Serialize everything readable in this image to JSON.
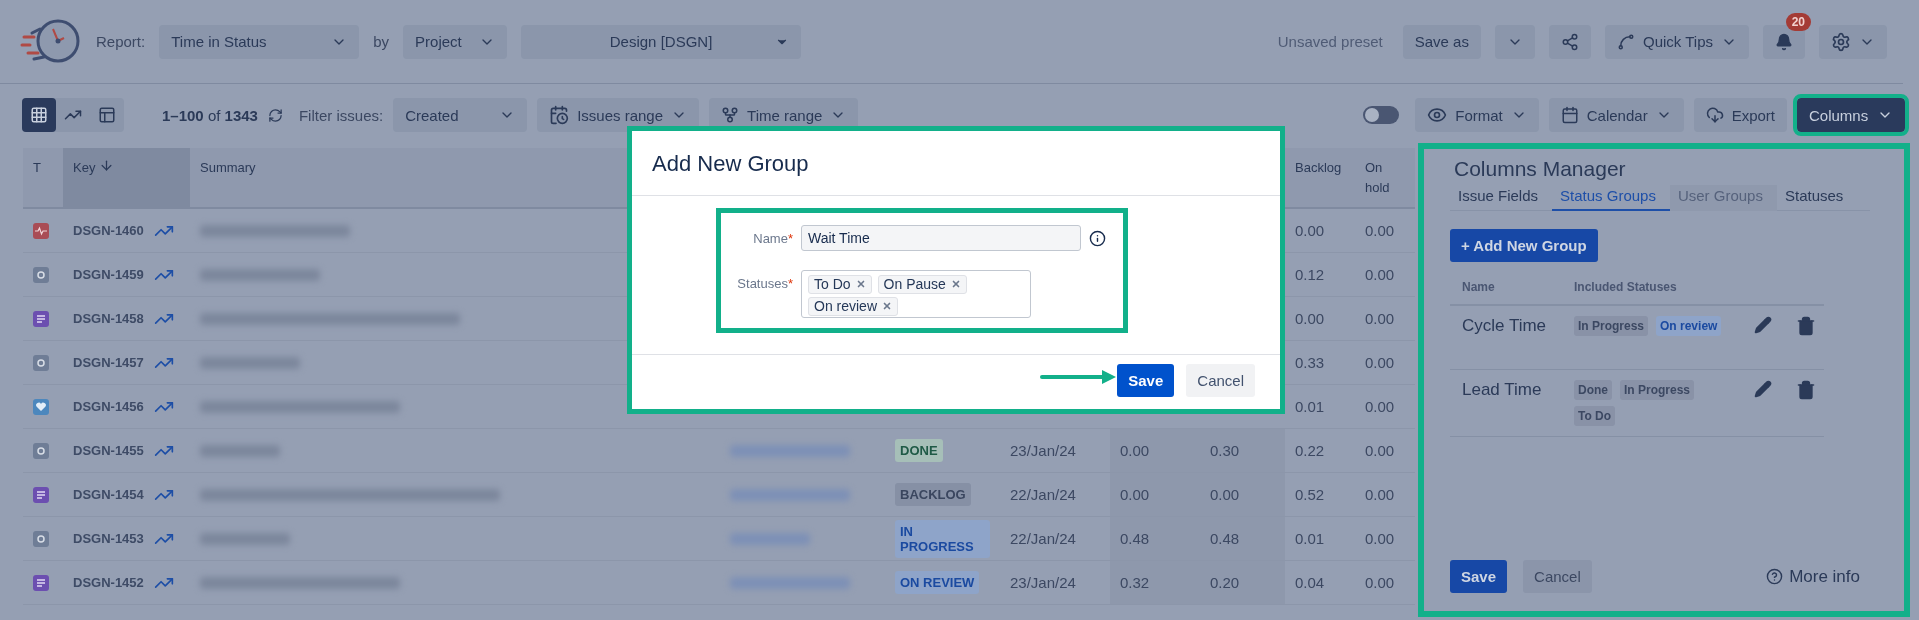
{
  "toolbar": {
    "report_label": "Report:",
    "report": "Time in Status",
    "by_label": "by",
    "group_by": "Project",
    "project": "Design [DSGN]",
    "preset": "Unsaved preset",
    "save_as": "Save as",
    "quick_tips": "Quick Tips",
    "notifications": "20"
  },
  "filters": {
    "views": [
      {
        "kind": "grid",
        "selected": true
      },
      {
        "kind": "chart",
        "selected": false
      },
      {
        "kind": "panel",
        "selected": false
      }
    ],
    "range": "**1–100** of **1343**",
    "filter_label": "Filter issues:",
    "filter": "Created",
    "issues_range": "Issues range",
    "time_range": "Time range",
    "toggle_on": false,
    "format": "Format",
    "calendar": "Calendar",
    "export": "Export",
    "columns": "Columns",
    "columns_open": true
  },
  "table": {
    "columns": [
      {
        "kind": "t",
        "label": "T",
        "sorted": false
      },
      {
        "kind": "key",
        "label": "Key",
        "sorted": true
      },
      {
        "kind": "summary",
        "label": "Summary",
        "sorted": false
      },
      {
        "kind": "backlog",
        "label": "Backlog",
        "sorted": false
      },
      {
        "kind": "on_hold",
        "label": "On hold",
        "sorted": false
      }
    ],
    "rows": [
      {
        "kind": "bug",
        "key": "DSGN-1460",
        "backlog": "0.00",
        "on_hold": "0.00"
      },
      {
        "kind": "subtask",
        "key": "DSGN-1459",
        "backlog": "0.12",
        "on_hold": "0.00"
      },
      {
        "kind": "story",
        "key": "DSGN-1458",
        "backlog": "0.00",
        "on_hold": "0.00"
      },
      {
        "kind": "subtask",
        "key": "DSGN-1457",
        "backlog": "0.33",
        "on_hold": "0.00"
      },
      {
        "kind": "heart",
        "key": "DSGN-1456",
        "backlog": "0.01",
        "on_hold": "0.00"
      },
      {
        "kind": "subtask",
        "key": "DSGN-1455",
        "status": {
          "label": "DONE",
          "kind": "done"
        },
        "date": "23/Jan/24",
        "col_a": "0.00",
        "col_b": "0.30",
        "backlog": "0.22",
        "on_hold": "0.00"
      },
      {
        "kind": "story",
        "key": "DSGN-1454",
        "status": {
          "label": "BACKLOG",
          "kind": "neutral"
        },
        "date": "22/Jan/24",
        "col_a": "0.00",
        "col_b": "0.00",
        "backlog": "0.52",
        "on_hold": "0.00"
      },
      {
        "kind": "subtask",
        "key": "DSGN-1453",
        "status": {
          "label": "IN PROGRESS",
          "kind": "progress"
        },
        "date": "22/Jan/24",
        "col_a": "0.48",
        "col_b": "0.48",
        "backlog": "0.01",
        "on_hold": "0.00"
      },
      {
        "kind": "story",
        "key": "DSGN-1452",
        "status": {
          "label": "ON REVIEW",
          "kind": "progress"
        },
        "date": "23/Jan/24",
        "col_a": "0.32",
        "col_b": "0.20",
        "backlog": "0.04",
        "on_hold": "0.00"
      }
    ]
  },
  "dialog": {
    "title": "Add New Group",
    "required_mark": "*",
    "name_label": "Name",
    "name_value": "Wait Time",
    "statuses_label": "Statuses",
    "statuses": [
      "To Do",
      "On Pause",
      "On review"
    ],
    "save": "Save",
    "cancel": "Cancel"
  },
  "columns_manager": {
    "title": "Columns Manager",
    "tabs": [
      {
        "label": "Issue Fields",
        "selected": false,
        "disabled": false
      },
      {
        "label": "Status Groups",
        "selected": true,
        "disabled": false
      },
      {
        "label": "User Groups",
        "selected": false,
        "disabled": true
      },
      {
        "label": "Statuses",
        "selected": false,
        "disabled": false
      }
    ],
    "add_button": "+ Add New Group",
    "headers": [
      "Name",
      "Included Statuses"
    ],
    "groups": [
      {
        "name": "Cycle Time",
        "statuses": [
          {
            "label": "In Progress",
            "highlighted": false
          },
          {
            "label": "On review",
            "highlighted": true
          }
        ]
      },
      {
        "name": "Lead Time",
        "statuses": [
          {
            "label": "Done",
            "highlighted": false
          },
          {
            "label": "In Progress",
            "highlighted": false
          },
          {
            "label": "To Do",
            "highlighted": false
          }
        ]
      }
    ],
    "save": "Save",
    "cancel": "Cancel",
    "more_info": "More info"
  }
}
